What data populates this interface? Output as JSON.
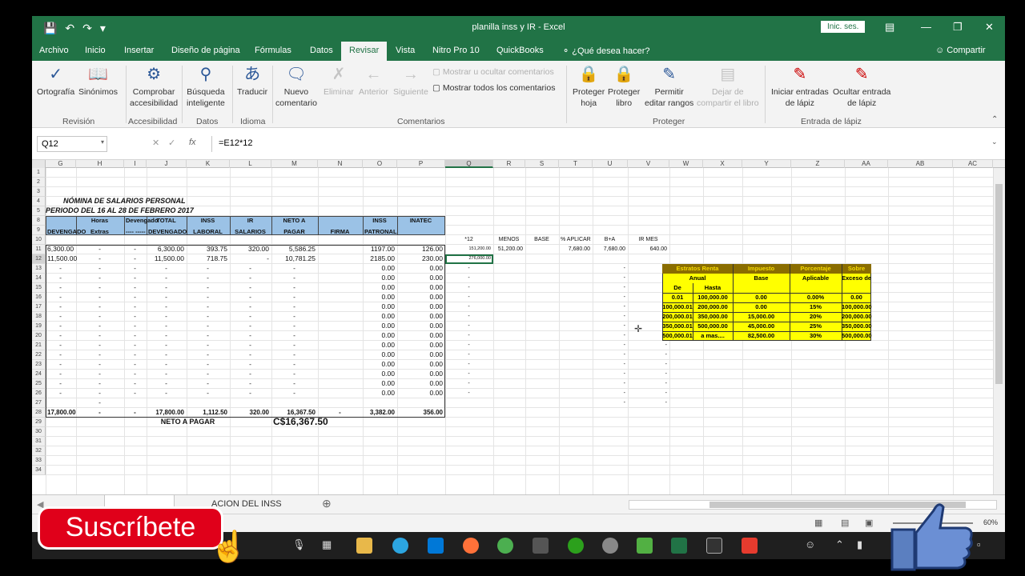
{
  "window": {
    "title": "planilla inss y IR  -  Excel",
    "signin": "Inic. ses."
  },
  "menu": {
    "tabs": [
      "Archivo",
      "Inicio",
      "Insertar",
      "Diseño de página",
      "Fórmulas",
      "Datos",
      "Revisar",
      "Vista",
      "Nitro Pro 10",
      "QuickBooks"
    ],
    "active": "Revisar",
    "tell": "¿Qué desea hacer?",
    "share": "Compartir"
  },
  "ribbon": {
    "buttons": {
      "ortografia": "Ortografía",
      "sinonimos": "Sinónimos",
      "comprobar1": "Comprobar",
      "comprobar2": "accesibilidad",
      "busqueda1": "Búsqueda",
      "busqueda2": "inteligente",
      "traducir": "Traducir",
      "nuevo1": "Nuevo",
      "nuevo2": "comentario",
      "eliminar": "Eliminar",
      "anterior": "Anterior",
      "siguiente": "Siguiente",
      "mostrar_ocultar": "Mostrar u ocultar comentarios",
      "mostrar_todos": "Mostrar todos los comentarios",
      "proteger_hoja1": "Proteger",
      "proteger_hoja2": "hoja",
      "proteger_libro1": "Proteger",
      "proteger_libro2": "libro",
      "permitir1": "Permitir",
      "permitir2": "editar rangos",
      "dejar1": "Dejar de",
      "dejar2": "compartir el libro",
      "iniciar1": "Iniciar entradas",
      "iniciar2": "de lápiz",
      "ocultar1": "Ocultar entrada",
      "ocultar2": "de lápiz"
    },
    "groups": {
      "revision": "Revisión",
      "accesibilidad": "Accesibilidad",
      "datos": "Datos",
      "idioma": "Idioma",
      "comentarios": "Comentarios",
      "proteger": "Proteger",
      "lapiz": "Entrada de lápiz"
    }
  },
  "formula_bar": {
    "name_box": "Q12",
    "fx": "fx",
    "formula": "=E12*12"
  },
  "columns": [
    "G",
    "H",
    "I",
    "J",
    "K",
    "L",
    "M",
    "N",
    "O",
    "P",
    "Q",
    "R",
    "S",
    "T",
    "U",
    "V",
    "W",
    "X",
    "Y",
    "Z",
    "AA",
    "AB",
    "AC"
  ],
  "rows": [
    "1",
    "2",
    "3",
    "4",
    "5",
    "8",
    "9",
    "10",
    "11",
    "12",
    "13",
    "14",
    "15",
    "16",
    "17",
    "18",
    "19",
    "20",
    "21",
    "22",
    "23",
    "24",
    "25",
    "26",
    "27",
    "28",
    "29",
    "30",
    "31",
    "32",
    "33",
    "34"
  ],
  "sheet": {
    "title1": "NÓMINA DE SALARIOS PERSONAL",
    "title2": "PERIODO DEL  16  AL 28  DE  FEBRERO 2017",
    "headers_top": {
      "h": "Horas",
      "i": "Devengado",
      "j": "TOTAL",
      "k": "INSS",
      "l": "IR",
      "m": "NETO A",
      "o": "INSS",
      "p": "INATEC"
    },
    "headers_bottom": {
      "g": "DEVENGADO",
      "h": "Extras",
      "i": "---- -----",
      "j": "DEVENGADO",
      "k": "LABORAL",
      "l": "SALARIOS",
      "m": "PAGAR",
      "n": "FIRMA",
      "o": "PATRONAL"
    },
    "side_headers": {
      "q": "*12",
      "r": "MENOS",
      "s": "BASE",
      "t": "% APLICAR",
      "u": "B+A",
      "v": "IR MES"
    },
    "row11": {
      "g": "6,300.00",
      "h": "-",
      "i": "-",
      "j": "6,300.00",
      "k": "393.75",
      "l": "320.00",
      "m": "5,586.25",
      "o": "1197.00",
      "p": "126.00",
      "q": "151,200.00",
      "r": "51,200.00",
      "t": "7,680.00",
      "u": "7,680.00",
      "v": "640.00"
    },
    "row12": {
      "g": "11,500.00",
      "h": "-",
      "i": "-",
      "j": "11,500.00",
      "k": "718.75",
      "l": "-",
      "m": "10,781.25",
      "o": "2185.00",
      "p": "230.00",
      "q": "276,000.00"
    },
    "empty_values": {
      "dash": "-",
      "zero": "0.00"
    },
    "totals": {
      "g": "17,800.00",
      "h": "-",
      "i": "-",
      "j": "17,800.00",
      "k": "1,112.50",
      "l": "320.00",
      "m": "16,367.50",
      "n": "-",
      "o": "3,382.00",
      "p": "356.00"
    },
    "neto_label": "NETO A PAGAR",
    "neto_value": "C$16,367.50",
    "ir_table": {
      "headers": {
        "estratos": "Estratos Renta",
        "anual": "Anual",
        "impuesto": "Impuesto",
        "porcentaje": "Porcentaje",
        "sobre": "Sobre",
        "de": "De",
        "hasta": "Hasta",
        "base": "Base",
        "aplicable": "Aplicable",
        "exceso": "Exceso de"
      },
      "rows": [
        [
          "0.01",
          "100,000.00",
          "0.00",
          "0.00%",
          "0.00"
        ],
        [
          "100,000.01",
          "200,000.00",
          "0.00",
          "15%",
          "100,000.00"
        ],
        [
          "200,000.01",
          "350,000.00",
          "15,000.00",
          "20%",
          "200,000.00"
        ],
        [
          "350,000.01",
          "500,000.00",
          "45,000.00",
          "25%",
          "350,000.00"
        ],
        [
          "500,000.01",
          "a mas....",
          "82,500.00",
          "30%",
          "500,000.00"
        ]
      ]
    }
  },
  "sheet_tabs": {
    "tab1": "",
    "tab2": "ACION DEL INSS"
  },
  "status": {
    "zoom": "60%"
  },
  "overlay": {
    "subscribe": "Suscríbete"
  }
}
